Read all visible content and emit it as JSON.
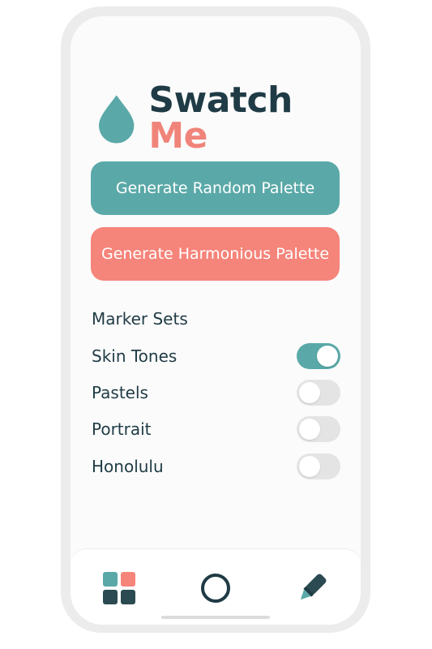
{
  "app": {
    "title_part_1": "Swatch",
    "title_part_2": "Me",
    "logo_icon": "water-drop-icon"
  },
  "buttons": {
    "random_label": "Generate Random Palette",
    "harmonious_label": "Generate Harmonious Palette"
  },
  "marker_sets": {
    "heading": "Marker Sets",
    "items": [
      {
        "label": "Skin Tones",
        "enabled": true
      },
      {
        "label": "Pastels",
        "enabled": false
      },
      {
        "label": "Portrait",
        "enabled": false
      },
      {
        "label": "Honolulu",
        "enabled": false
      }
    ]
  },
  "bottom_nav": {
    "items": [
      {
        "icon": "palette-grid-icon"
      },
      {
        "icon": "circle-icon"
      },
      {
        "icon": "marker-icon"
      }
    ]
  },
  "colors": {
    "teal": "#5aa9a8",
    "coral": "#f5847a",
    "dark": "#1f3b45",
    "toggle_off": "#e4e4e4"
  }
}
